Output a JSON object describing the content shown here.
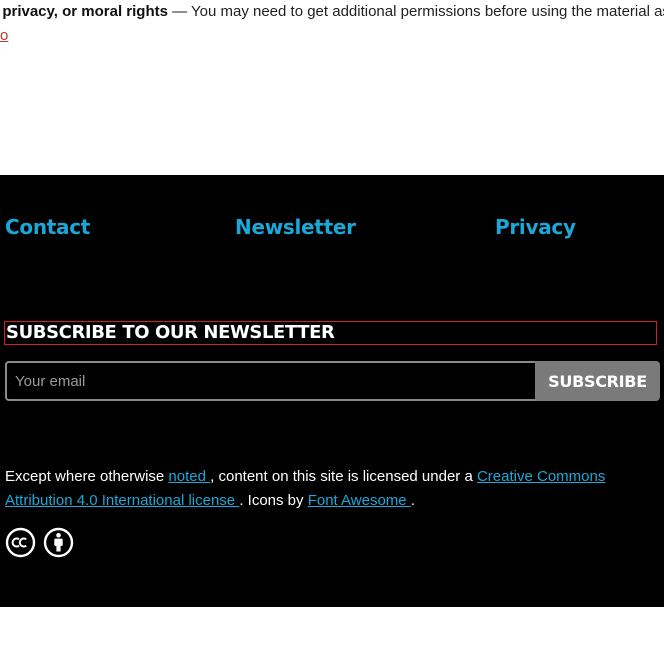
{
  "top": {
    "bold_text": ", privacy, or moral rights",
    "rest_text": " — You may need to get additional permissions before using the material as",
    "link_fragment": "o"
  },
  "footer": {
    "nav": [
      {
        "label": "Contact"
      },
      {
        "label": "Newsletter"
      },
      {
        "label": "Privacy"
      }
    ],
    "newsletter": {
      "heading": "SUBSCRIBE TO OUR NEWSLETTER",
      "email_placeholder": "Your email",
      "button_label": "SUBSCRIBE"
    },
    "license": {
      "part1": "Except where otherwise ",
      "noted_link": "noted ",
      "part2": ", content on this site is licensed under a ",
      "cc_link": "Creative Commons Attribution 4.0 International license ",
      "part3": ". Icons by ",
      "fa_link": "Font Awesome ",
      "part4": "."
    }
  },
  "colors": {
    "link_blue": "#1ba8d8",
    "footer_bg": "#000000",
    "button_gray": "#7a7a7a",
    "focus_red": "#d02020"
  },
  "icons": [
    "creative-commons-icon",
    "attribution-icon"
  ]
}
